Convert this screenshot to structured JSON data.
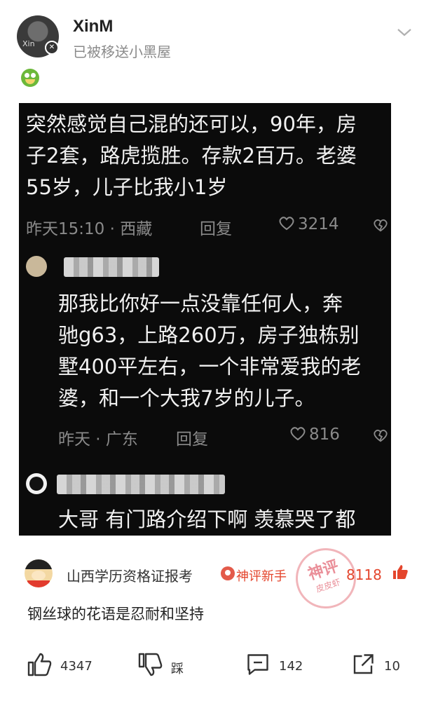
{
  "post": {
    "username": "XinM",
    "avatar_label": "Xin",
    "status": "已被移送小黑屋"
  },
  "screenshot": {
    "main_comment": {
      "lines": [
        "突然感觉自己混的还可以，90年，房",
        "子2套，路虎揽胜。存款2百万。老婆",
        "55岁，儿子比我小1岁"
      ],
      "meta": "昨天15:10 · 西藏",
      "reply_label": "回复",
      "likes": "3214"
    },
    "reply_1": {
      "lines": [
        "那我比你好一点没靠任何人，奔",
        "驰g63，上路260万，房子独栋别",
        "墅400平左右，一个非常爱我的老",
        "婆，和一个大我7岁的儿子。"
      ],
      "meta": "昨天 · 广东",
      "reply_label": "回复",
      "likes": "816"
    },
    "reply_2": {
      "text": "大哥 有门路介绍下啊 羡慕哭了都"
    }
  },
  "hot_comment": {
    "user": "山西学历资格证报考",
    "tag": "神评新手",
    "stamp_text": "神评",
    "stamp_sub": "皮皮虾",
    "likes": "8118",
    "text": "钢丝球的花语是忍耐和坚持"
  },
  "actions": {
    "like_count": "4347",
    "dislike_label": "踩",
    "comment_count": "142",
    "share_count": "10"
  },
  "icons": [
    "chevron-down-icon",
    "emoji-icon",
    "heart-icon",
    "broken-heart-icon",
    "thumb-up-icon",
    "thumb-down-icon",
    "comment-icon",
    "share-icon"
  ],
  "colors": {
    "accent": "#e4452c",
    "screenshot_bg": "#0b0b0b",
    "muted": "#8a8a8a"
  }
}
